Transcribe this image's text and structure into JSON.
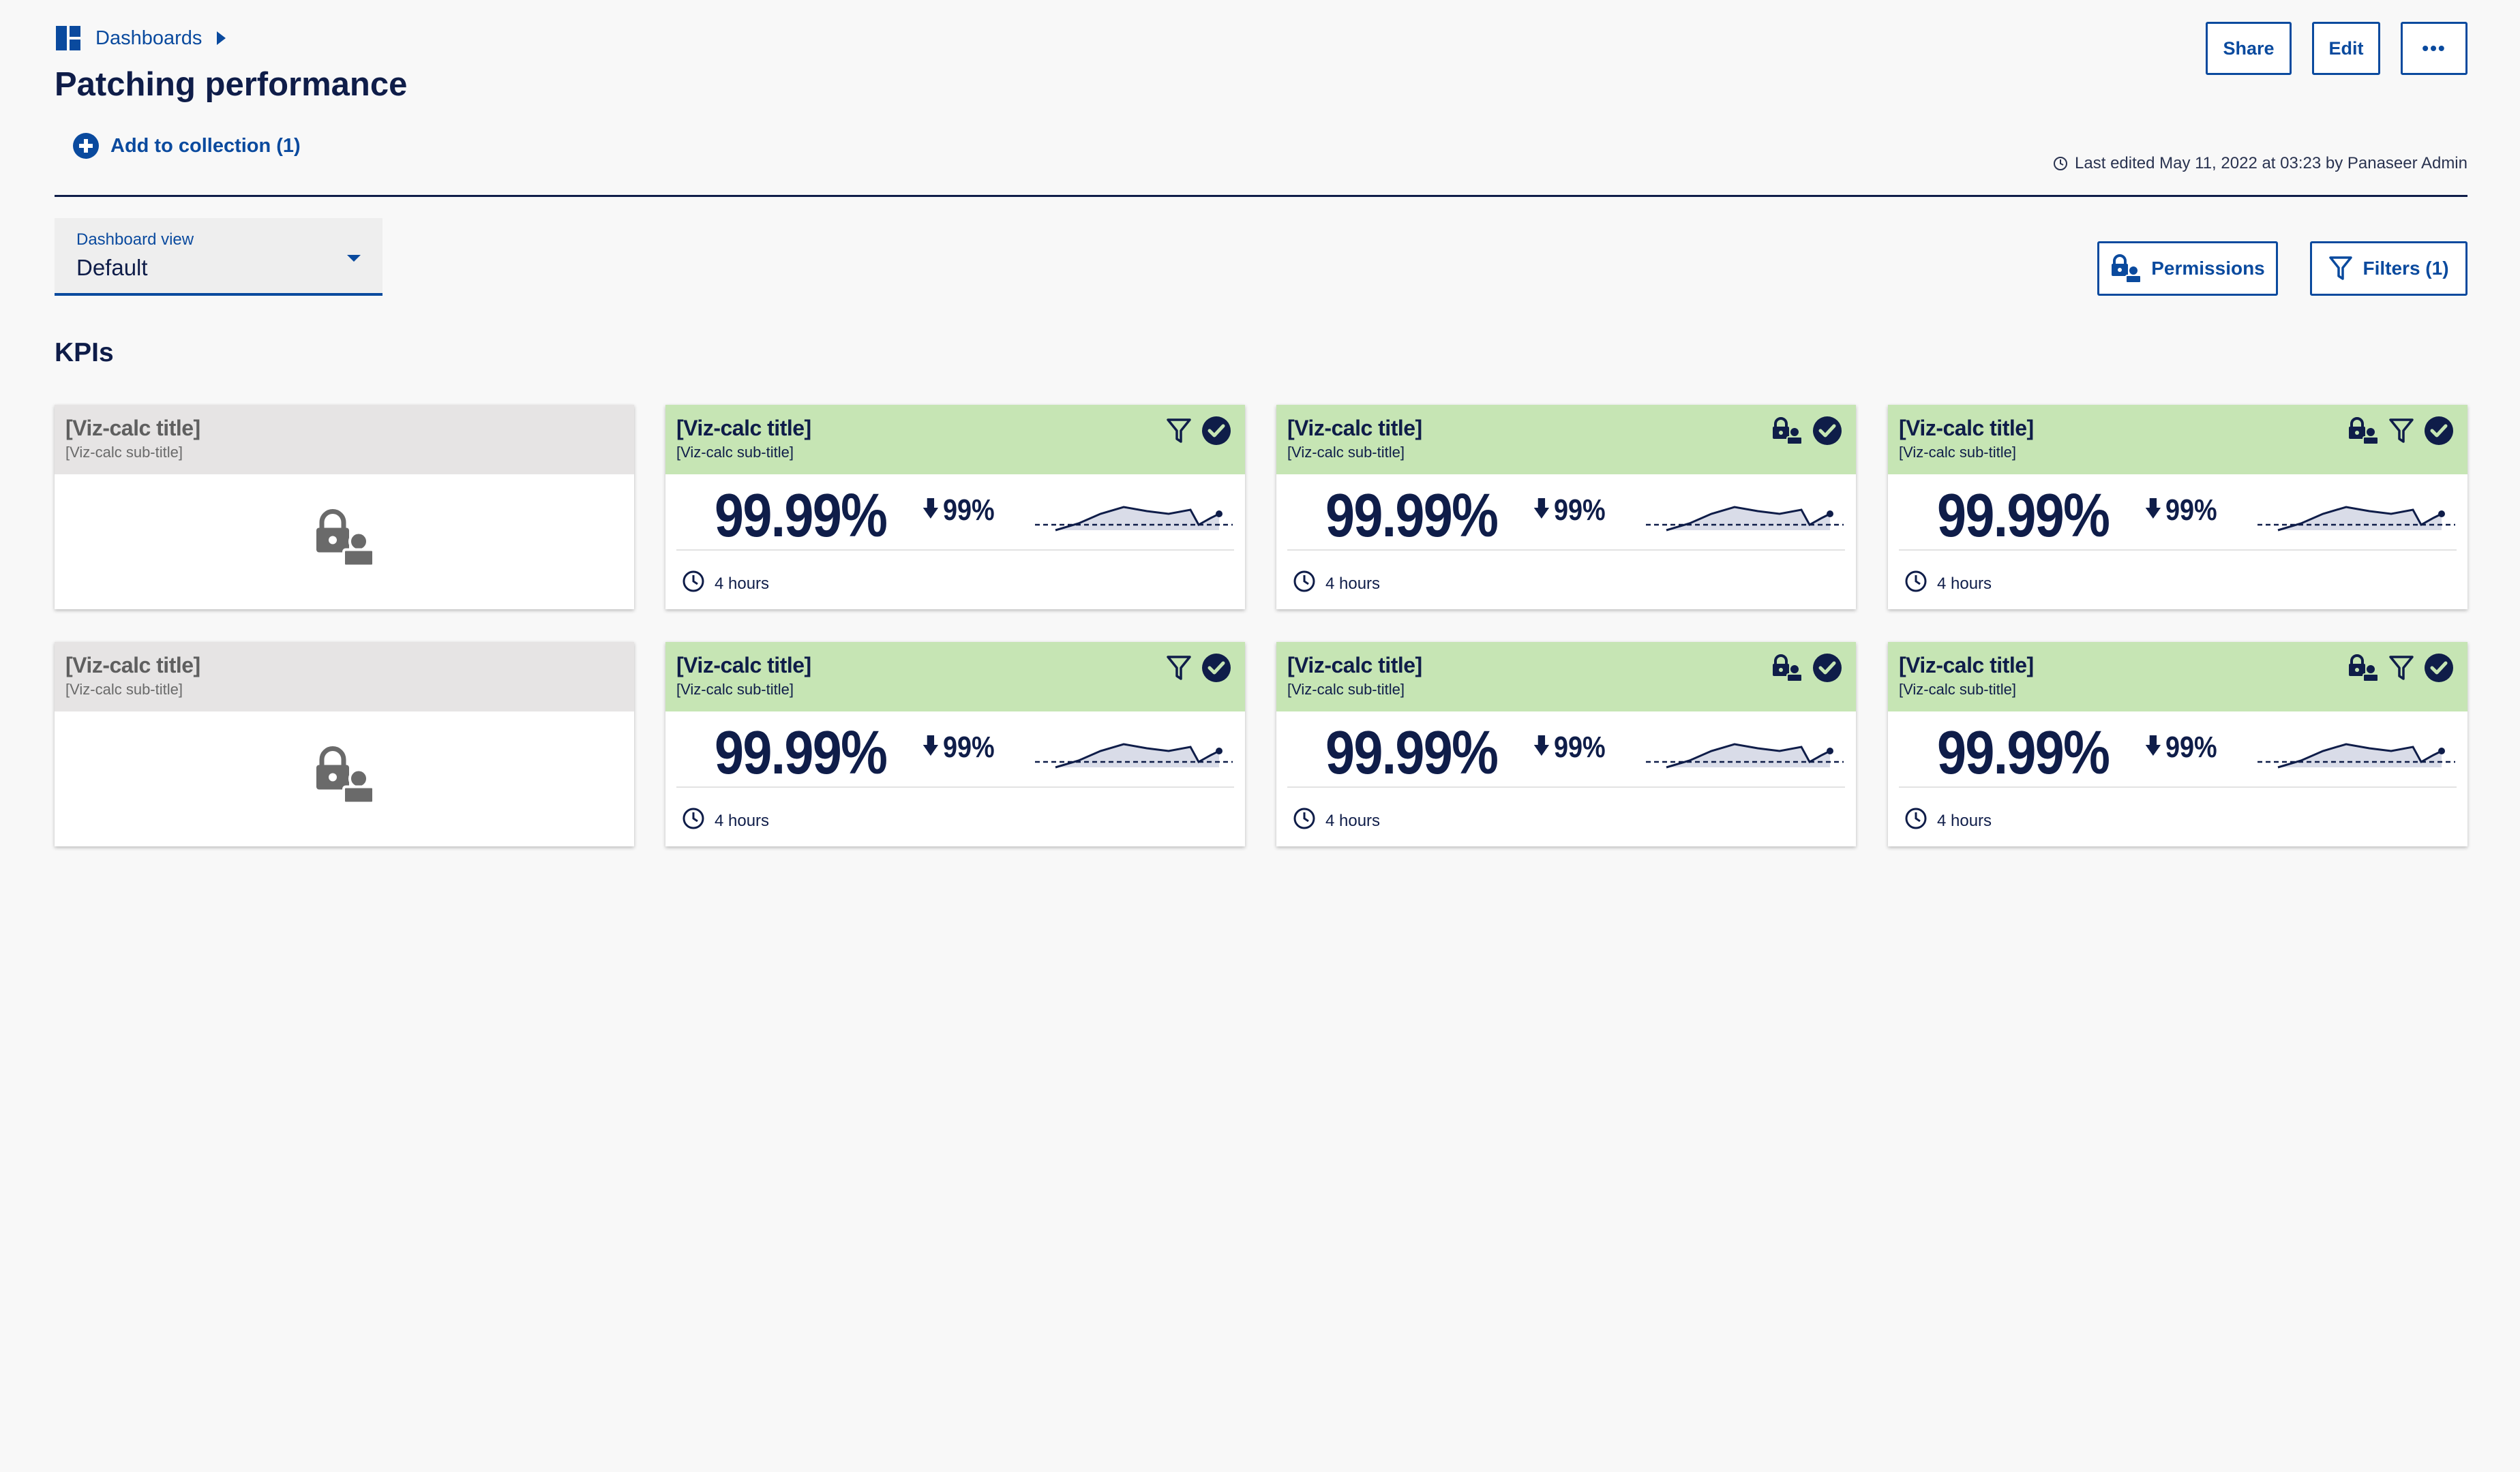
{
  "breadcrumb": {
    "label": "Dashboards"
  },
  "page": {
    "title": "Patching performance"
  },
  "collection": {
    "label": "Add to collection (1)"
  },
  "header": {
    "share": "Share",
    "edit": "Edit",
    "more": "•••"
  },
  "last_edited": "Last edited May 11, 2022 at 03:23 by Panaseer Admin",
  "view": {
    "label": "Dashboard view",
    "value": "Default"
  },
  "controls": {
    "permissions": "Permissions",
    "filters": "Filters (1)"
  },
  "section": {
    "title": "KPIs"
  },
  "colors": {
    "accent": "#0a4a9e",
    "text": "#0f1d49",
    "card_header": "#c6e5b4",
    "locked_header": "#e6e4e4"
  },
  "cards": [
    {
      "title": "[Viz-calc title]",
      "subtitle": "[Viz-calc sub-title]",
      "locked": true,
      "icons": [
        "lock-user-icon"
      ]
    },
    {
      "title": "[Viz-calc title]",
      "subtitle": "[Viz-calc sub-title]",
      "value": "99.99%",
      "delta": "99%",
      "delta_direction": "down",
      "time": "4 hours",
      "icons": [
        "filter-icon",
        "check-circle-icon"
      ]
    },
    {
      "title": "[Viz-calc title]",
      "subtitle": "[Viz-calc sub-title]",
      "value": "99.99%",
      "delta": "99%",
      "delta_direction": "down",
      "time": "4 hours",
      "icons": [
        "lock-user-icon",
        "check-circle-icon"
      ]
    },
    {
      "title": "[Viz-calc title]",
      "subtitle": "[Viz-calc sub-title]",
      "value": "99.99%",
      "delta": "99%",
      "delta_direction": "down",
      "time": "4 hours",
      "icons": [
        "lock-user-icon",
        "filter-icon",
        "check-circle-icon"
      ]
    },
    {
      "title": "[Viz-calc title]",
      "subtitle": "[Viz-calc sub-title]",
      "locked": true,
      "icons": [
        "lock-user-icon"
      ]
    },
    {
      "title": "[Viz-calc title]",
      "subtitle": "[Viz-calc sub-title]",
      "value": "99.99%",
      "delta": "99%",
      "delta_direction": "down",
      "time": "4 hours",
      "icons": [
        "filter-icon",
        "check-circle-icon"
      ]
    },
    {
      "title": "[Viz-calc title]",
      "subtitle": "[Viz-calc sub-title]",
      "value": "99.99%",
      "delta": "99%",
      "delta_direction": "down",
      "time": "4 hours",
      "icons": [
        "lock-user-icon",
        "check-circle-icon"
      ]
    },
    {
      "title": "[Viz-calc title]",
      "subtitle": "[Viz-calc sub-title]",
      "value": "99.99%",
      "delta": "99%",
      "delta_direction": "down",
      "time": "4 hours",
      "icons": [
        "lock-user-icon",
        "filter-icon",
        "check-circle-icon"
      ]
    }
  ]
}
